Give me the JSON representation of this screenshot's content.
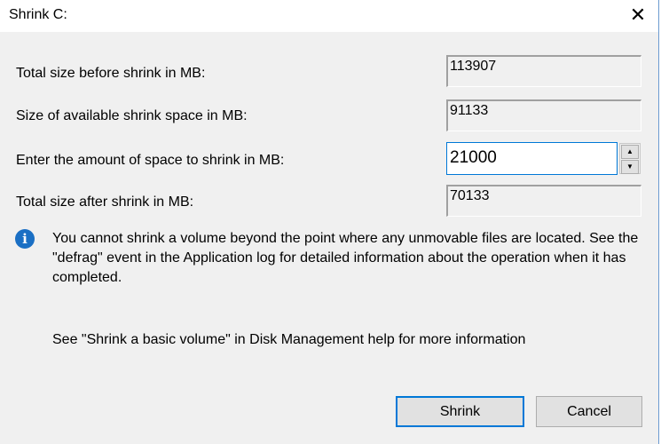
{
  "window": {
    "title": "Shrink C:",
    "close_icon": "close-icon"
  },
  "fields": [
    {
      "label": "Total size before shrink in MB:",
      "value": "113907"
    },
    {
      "label": "Size of available shrink space in MB:",
      "value": "91133"
    },
    {
      "label": "Enter the amount of space to shrink in MB:",
      "value": "21000"
    },
    {
      "label": "Total size after shrink in MB:",
      "value": "70133"
    }
  ],
  "info": {
    "icon": "info-icon",
    "message": "You cannot shrink a volume beyond the point where any unmovable files are located. See the \"defrag\" event in the Application log for detailed information about the operation when it has completed."
  },
  "help_text": "See \"Shrink a basic volume\" in Disk Management help for more information",
  "buttons": {
    "shrink": "Shrink",
    "cancel": "Cancel"
  },
  "colors": {
    "accent": "#0078d7",
    "info": "#1a6fc4"
  }
}
